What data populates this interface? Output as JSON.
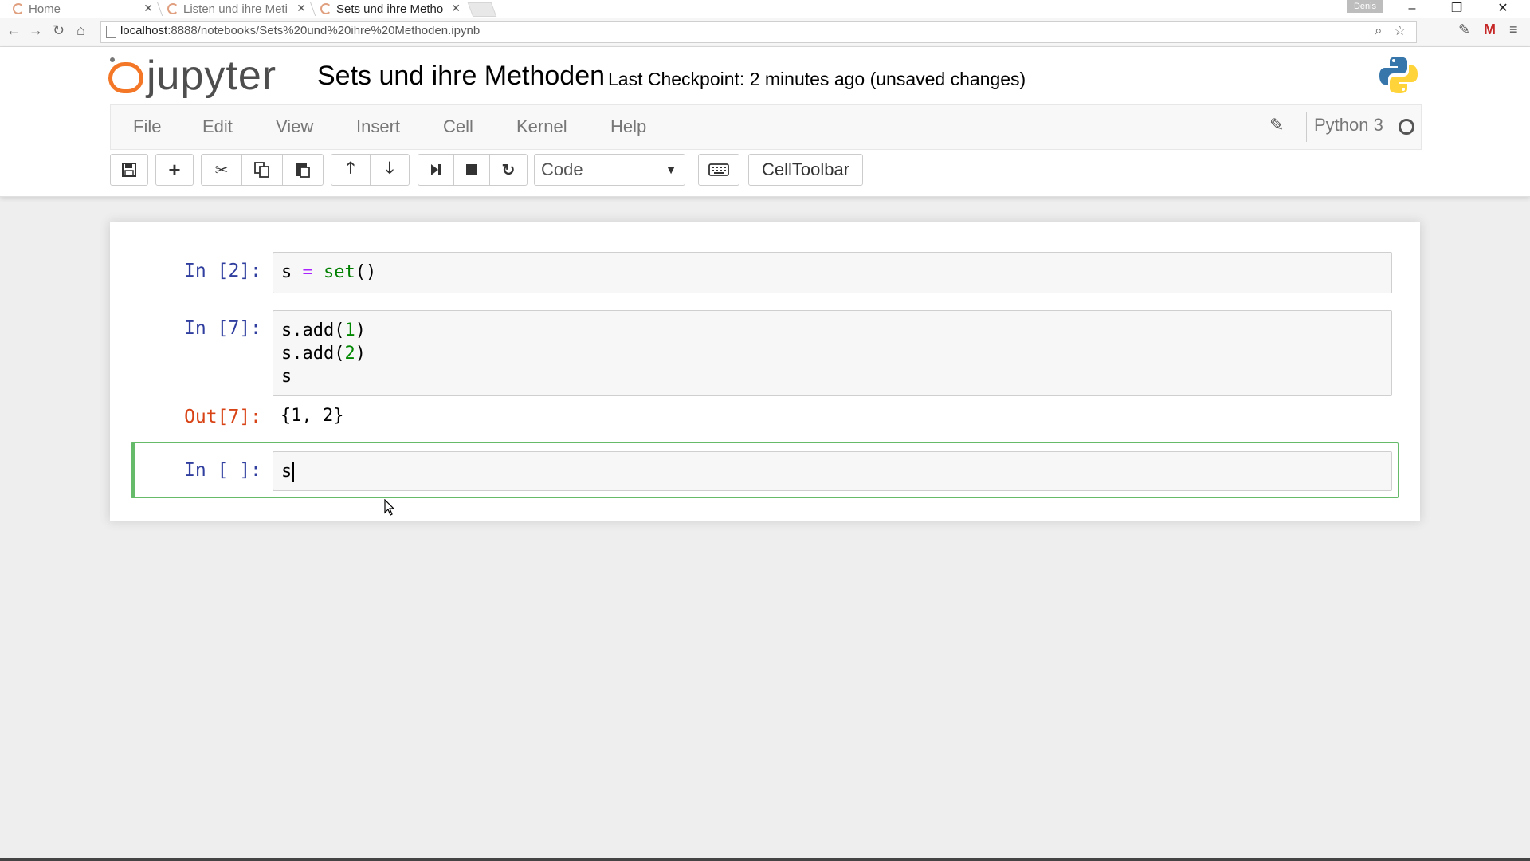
{
  "browser": {
    "tabs": [
      {
        "title": "Home"
      },
      {
        "title": "Listen und ihre Meti"
      },
      {
        "title": "Sets und ihre Metho"
      }
    ],
    "profile": "Denis",
    "url_host": "localhost",
    "url_path": ":8888/notebooks/Sets%20und%20ihre%20Methoden.ipynb"
  },
  "header": {
    "logo_text": "jupyter",
    "notebook_name": "Sets und ihre Methoden",
    "checkpoint": "Last Checkpoint: 2 minutes ago (unsaved changes)"
  },
  "menubar": {
    "items": [
      "File",
      "Edit",
      "View",
      "Insert",
      "Cell",
      "Kernel",
      "Help"
    ],
    "kernel_name": "Python 3"
  },
  "toolbar": {
    "cell_type": "Code",
    "celltoolbar_label": "CellToolbar"
  },
  "cells": [
    {
      "prompt": "In [2]:",
      "code_line1": "s = set()"
    },
    {
      "prompt": "In [7]:",
      "lines": [
        "s.add(1)",
        "s.add(2)",
        "s"
      ],
      "out_prompt": "Out[7]:",
      "output": "{1, 2}"
    },
    {
      "prompt": "In [ ]:",
      "code": "s"
    }
  ],
  "colors": {
    "accent_orange": "#f37726",
    "in_prompt": "#303f9f",
    "out_prompt": "#d84315",
    "selected_border": "#66bb6a"
  }
}
